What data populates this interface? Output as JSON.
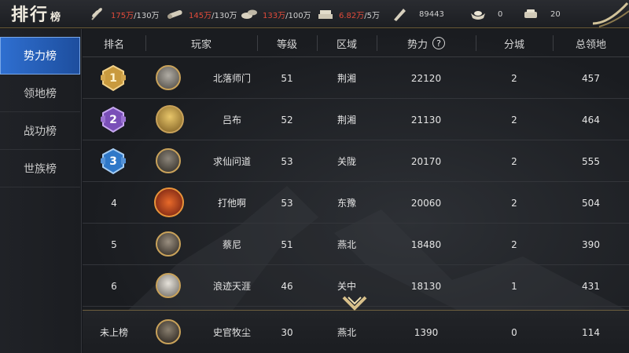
{
  "header": {
    "title_big": "排行",
    "title_small": "榜",
    "resources": [
      {
        "icon": "wheat-icon",
        "current": "175万",
        "max": "/130万"
      },
      {
        "icon": "wood-icon",
        "current": "145万",
        "max": "/130万"
      },
      {
        "icon": "stone-icon",
        "current": "133万",
        "max": "/100万"
      },
      {
        "icon": "iron-icon",
        "current": "6.82万",
        "max": "/5万"
      },
      {
        "icon": "copper-coin-icon",
        "value": "89443"
      },
      {
        "icon": "gold-ingot-icon",
        "value": "0"
      },
      {
        "icon": "silver-ingot-icon",
        "value": "20"
      }
    ]
  },
  "sidebar": {
    "items": [
      {
        "label": "势力榜",
        "active": true
      },
      {
        "label": "领地榜",
        "active": false
      },
      {
        "label": "战功榜",
        "active": false
      },
      {
        "label": "世族榜",
        "active": false
      }
    ]
  },
  "table": {
    "columns": [
      "排名",
      "玩家",
      "等级",
      "区域",
      "势力",
      "分城",
      "总领地"
    ],
    "help_glyph": "?",
    "rows": [
      {
        "rank": "1",
        "medal": "gold",
        "name": "北落师门",
        "level": "51",
        "region": "荆湘",
        "power": "22120",
        "cities": "2",
        "territory": "457"
      },
      {
        "rank": "2",
        "medal": "purple",
        "name": "吕布",
        "level": "52",
        "region": "荆湘",
        "power": "21130",
        "cities": "2",
        "territory": "464"
      },
      {
        "rank": "3",
        "medal": "blue",
        "name": "求仙问道",
        "level": "53",
        "region": "关陇",
        "power": "20170",
        "cities": "2",
        "territory": "555"
      },
      {
        "rank": "4",
        "name": "打他啊",
        "level": "53",
        "region": "东豫",
        "power": "20060",
        "cities": "2",
        "territory": "504"
      },
      {
        "rank": "5",
        "name": "蔡尼",
        "level": "51",
        "region": "燕北",
        "power": "18480",
        "cities": "2",
        "territory": "390"
      },
      {
        "rank": "6",
        "name": "浪迹天涯",
        "level": "46",
        "region": "关中",
        "power": "18130",
        "cities": "1",
        "territory": "431"
      }
    ],
    "self": {
      "rank": "未上榜",
      "name": "史官牧尘",
      "level": "30",
      "region": "燕北",
      "power": "1390",
      "cities": "0",
      "territory": "114"
    }
  },
  "colors": {
    "accent_tab": "#2f6fd0",
    "resource_over": "#e04a3a",
    "gold_border": "#c9a25a"
  }
}
